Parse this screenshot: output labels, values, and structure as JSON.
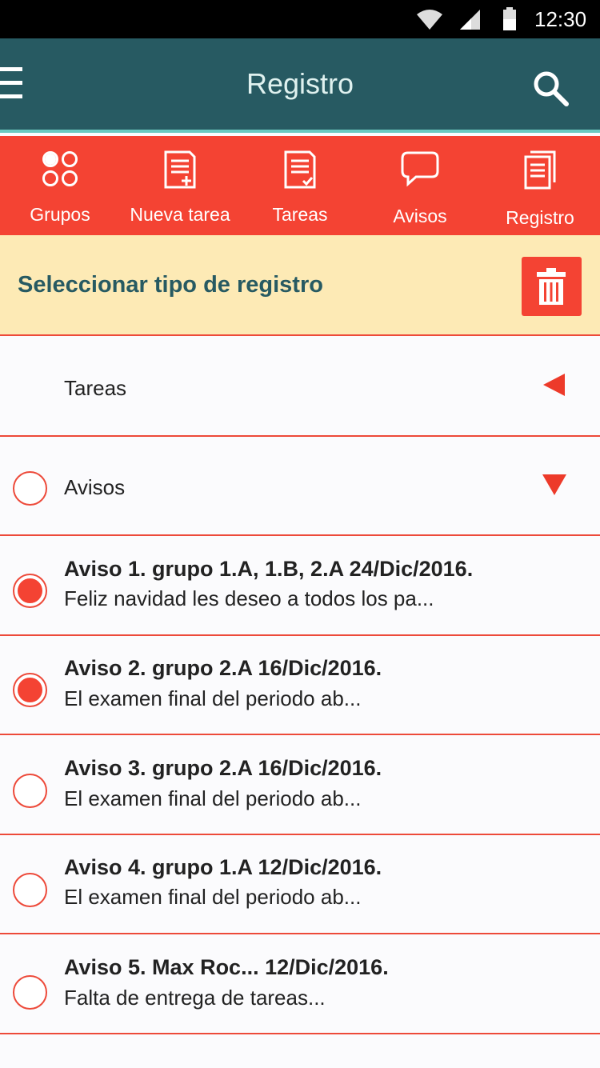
{
  "status_bar": {
    "time": "12:30"
  },
  "app_bar": {
    "title": "Registro"
  },
  "tabs": [
    {
      "label": "Grupos",
      "icon": "groups-icon"
    },
    {
      "label": "Nueva tarea",
      "icon": "new-task-icon"
    },
    {
      "label": "Tareas",
      "icon": "tasks-icon"
    },
    {
      "label": "Avisos",
      "icon": "chat-bubble-icon"
    },
    {
      "label": "Registro",
      "icon": "log-icon"
    }
  ],
  "section": {
    "title": "Seleccionar tipo de registro"
  },
  "categories": [
    {
      "label": "Tareas",
      "state": "collapsed"
    },
    {
      "label": "Avisos",
      "state": "expanded"
    }
  ],
  "notices": [
    {
      "title": "Aviso 1. grupo 1.A, 1.B, 2.A 24/Dic/2016.",
      "body": "Feliz navidad les deseo a todos los pa...",
      "selected": true
    },
    {
      "title": "Aviso 2. grupo 2.A 16/Dic/2016.",
      "body": "El examen final del periodo ab...",
      "selected": true
    },
    {
      "title": "Aviso 3. grupo 2.A 16/Dic/2016.",
      "body": "El examen final del periodo ab...",
      "selected": false
    },
    {
      "title": "Aviso 4. grupo 1.A 12/Dic/2016.",
      "body": "El examen final del periodo ab...",
      "selected": false
    },
    {
      "title": "Aviso 5. Max Roc... 12/Dic/2016.",
      "body": "Falta de entrega de tareas...",
      "selected": false
    }
  ],
  "colors": {
    "app_bar": "#275a62",
    "accent": "#f44333",
    "section_bg": "#fdeab5",
    "divider": "#ed4a3a"
  }
}
